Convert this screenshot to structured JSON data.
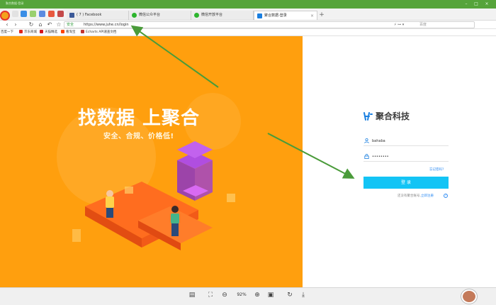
{
  "window": {
    "title": "聚合数据-登录"
  },
  "tabs": [
    {
      "label": "( 7 ) Facebook",
      "favicon_color": "#3b5998"
    },
    {
      "label": "微信公众平台",
      "favicon_color": "#2db52e"
    },
    {
      "label": "微信开放平台",
      "favicon_color": "#2db52e"
    },
    {
      "label": "聚合数据-登录",
      "favicon_color": "#1a7fe0",
      "active": true
    }
  ],
  "new_tab_label": "+",
  "address": {
    "secure_label": "安全",
    "url": "https://www.juhe.cn/login",
    "search_placeholder": "百度"
  },
  "bookmarks": [
    {
      "label": "百度一下",
      "color": "#2e57d6"
    },
    {
      "label": "京东商城",
      "color": "#e1251b"
    },
    {
      "label": "天猫精选",
      "color": "#d4141d"
    },
    {
      "label": "看淘宝",
      "color": "#ff4400"
    },
    {
      "label": "Echarts API速查文档",
      "color": "#c23531"
    }
  ],
  "hero": {
    "title": "找数据 上聚合",
    "subtitle": "安全、合规、价格低!"
  },
  "login": {
    "brand_name": "聚合科技",
    "username_value": "bahaba",
    "password_value": "••••••••",
    "forgot_label": "忘记密码?",
    "submit_label": "登 录",
    "register_prompt": "还没有聚合账号,",
    "register_link": "立即注册"
  },
  "viewer": {
    "zoom_label": "92%"
  },
  "colors": {
    "hero_orange": "#ff9f0e",
    "login_button": "#13c4f5",
    "arrow_green": "#4a9b3a",
    "titlebar_green": "#56a43b"
  }
}
